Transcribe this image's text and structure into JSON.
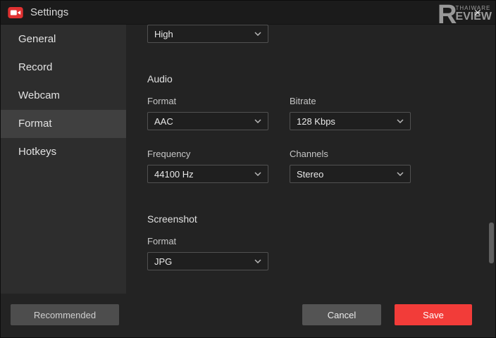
{
  "titlebar": {
    "title": "Settings",
    "close": "✕"
  },
  "watermark": {
    "big": "R",
    "small": "THAIWARE",
    "rest": "EVIEW"
  },
  "sidebar": {
    "items": [
      {
        "label": "General"
      },
      {
        "label": "Record"
      },
      {
        "label": "Webcam"
      },
      {
        "label": "Format"
      },
      {
        "label": "Hotkeys"
      }
    ],
    "active": "Format"
  },
  "content": {
    "top_field": {
      "value": "High"
    },
    "sections": [
      {
        "title": "Audio",
        "fields": [
          {
            "label": "Format",
            "value": "AAC"
          },
          {
            "label": "Bitrate",
            "value": "128 Kbps"
          },
          {
            "label": "Frequency",
            "value": "44100 Hz"
          },
          {
            "label": "Channels",
            "value": "Stereo"
          }
        ]
      },
      {
        "title": "Screenshot",
        "fields": [
          {
            "label": "Format",
            "value": "JPG"
          }
        ]
      }
    ]
  },
  "footer": {
    "recommended": "Recommended",
    "cancel": "Cancel",
    "save": "Save"
  },
  "colors": {
    "accent_red": "#f23c39",
    "sidebar_bg": "#2d2d2d",
    "content_bg": "#232323",
    "titlebar_bg": "#1b1b1b"
  }
}
